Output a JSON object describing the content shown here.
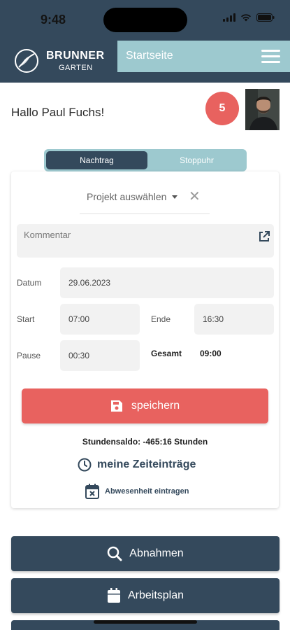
{
  "status_bar": {
    "time": "9:48"
  },
  "header": {
    "logo_line1": "BRUNNER",
    "logo_line2": "GARTEN",
    "title": "Startseite"
  },
  "greeting": "Hallo Paul Fuchs!",
  "notification_count": "5",
  "segment": {
    "active": "Nachtrag",
    "inactive": "Stoppuhr"
  },
  "form": {
    "project_placeholder": "Projekt auswählen",
    "project_clear": "✕",
    "comment_placeholder": "Kommentar",
    "date_label": "Datum",
    "date_value": "29.06.2023",
    "start_label": "Start",
    "start_value": "07:00",
    "end_label": "Ende",
    "end_value": "16:30",
    "pause_label": "Pause",
    "pause_value": "00:30",
    "total_label": "Gesamt",
    "total_value": "09:00",
    "save_label": "speichern"
  },
  "balance_text": "Stundensaldo: -465:16 Stunden",
  "links": {
    "entries": "meine Zeiteinträge",
    "absence": "Abwesenheit eintragen"
  },
  "buttons": {
    "inspections": "Abnahmen",
    "work_plan": "Arbeitsplan"
  },
  "colors": {
    "primary": "#34495c",
    "accent": "#9dc9cf",
    "danger": "#e8625f"
  }
}
